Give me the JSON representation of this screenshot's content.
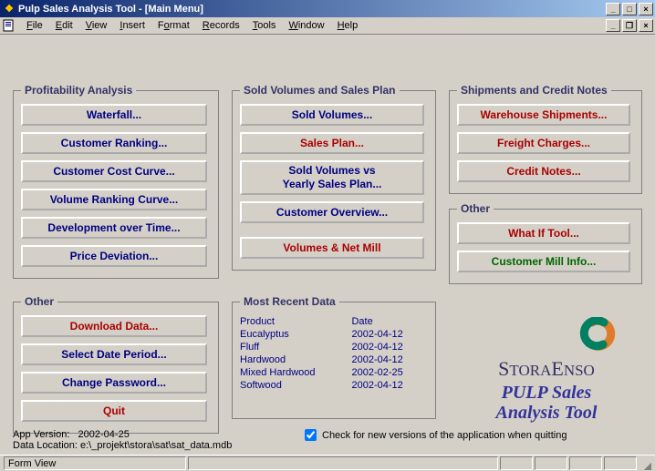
{
  "window": {
    "title": "Pulp Sales Analysis Tool - [Main Menu]",
    "controls": {
      "min": "_",
      "max": "□",
      "close": "×"
    }
  },
  "menu": {
    "file": "File",
    "edit": "Edit",
    "view": "View",
    "insert": "Insert",
    "format": "Format",
    "records": "Records",
    "tools": "Tools",
    "window": "Window",
    "help": "Help"
  },
  "groups": {
    "profitability": {
      "legend": "Profitability Analysis",
      "waterfall": "Waterfall...",
      "customer_ranking": "Customer Ranking...",
      "customer_cost_curve": "Customer Cost Curve...",
      "volume_ranking_curve": "Volume Ranking Curve...",
      "development_over_time": "Development over Time...",
      "price_deviation": "Price Deviation..."
    },
    "sold": {
      "legend": "Sold Volumes and Sales Plan",
      "sold_volumes": "Sold Volumes...",
      "sales_plan": "Sales Plan...",
      "sold_vs_plan": "Sold Volumes vs\nYearly Sales Plan...",
      "customer_overview": "Customer Overview...",
      "volumes_net_mill": "Volumes & Net Mill"
    },
    "shipments": {
      "legend": "Shipments and Credit Notes",
      "warehouse_shipments": "Warehouse Shipments...",
      "freight_charges": "Freight Charges...",
      "credit_notes": "Credit Notes..."
    },
    "right_other": {
      "legend": "Other",
      "what_if": "What If Tool...",
      "customer_mill_info": "Customer Mill Info..."
    },
    "left_other": {
      "legend": "Other",
      "download_data": "Download Data...",
      "select_date_period": "Select Date Period...",
      "change_password": "Change Password...",
      "quit": "Quit"
    },
    "recent": {
      "legend": "Most Recent Data",
      "header_product": "Product",
      "header_date": "Date",
      "rows": [
        {
          "product": "Eucalyptus",
          "date": "2002-04-12"
        },
        {
          "product": "Fluff",
          "date": "2002-04-12"
        },
        {
          "product": "Hardwood",
          "date": "2002-04-12"
        },
        {
          "product": "Mixed Hardwood",
          "date": "2002-02-25"
        },
        {
          "product": "Softwood",
          "date": "2002-04-12"
        }
      ]
    }
  },
  "brand": {
    "company": "STORAENSO",
    "subtitle_line1": "PULP Sales",
    "subtitle_line2": "Analysis Tool"
  },
  "footer": {
    "version_label": "App Version:",
    "version_value": "2002-04-25",
    "data_location_label": "Data Location:",
    "data_location_value": "e:\\_projekt\\stora\\sat\\sat_data.mdb",
    "check_updates_label": "Check for new versions of the application when quitting",
    "check_updates_checked": true
  },
  "statusbar": {
    "view": "Form View",
    "kb1": "",
    "kb2": "",
    "kb3": "",
    "kb4": ""
  }
}
